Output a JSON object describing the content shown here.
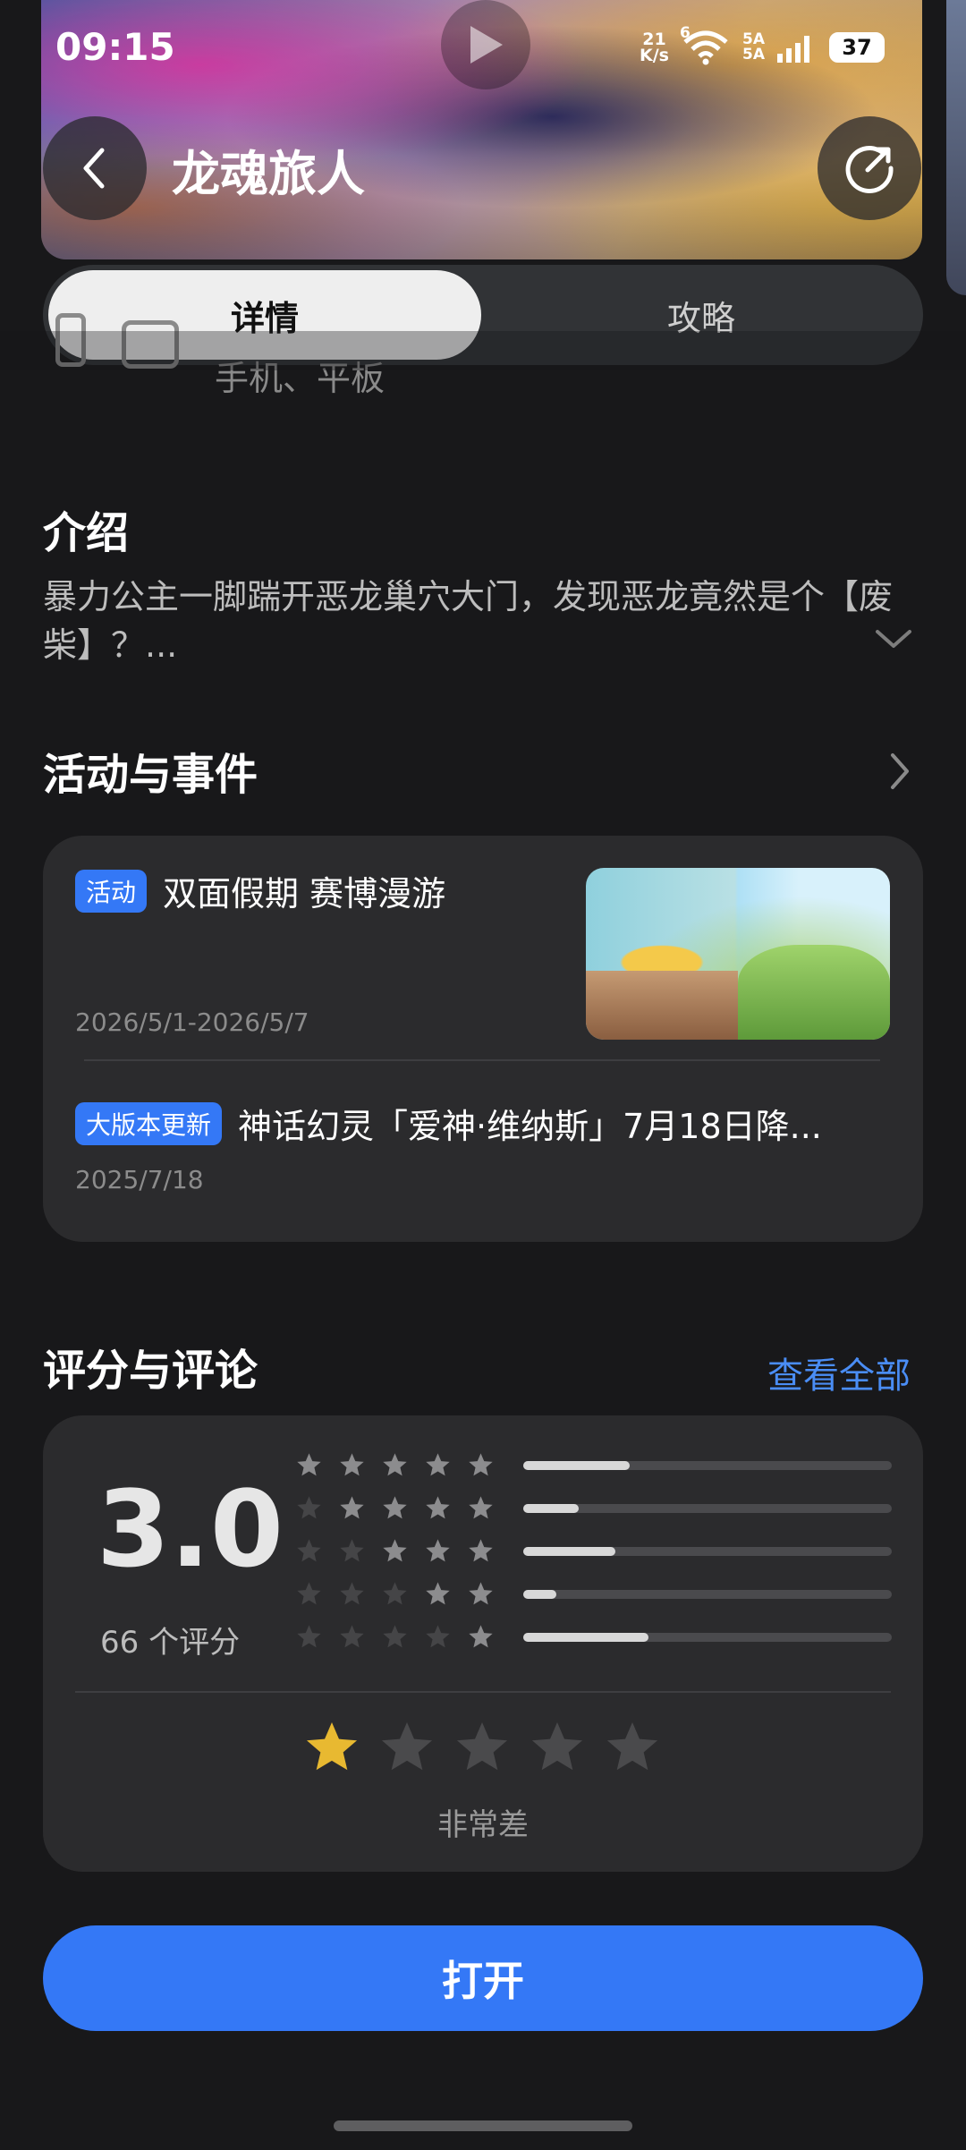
{
  "status_bar": {
    "time": "09:15",
    "net_speed_value": "21",
    "net_speed_unit": "K/s",
    "wifi_badge": "6",
    "sim1": "5A",
    "sim2": "5A",
    "battery": "37"
  },
  "header": {
    "title": "龙魂旅人",
    "back_icon": "chevron-left-icon",
    "share_icon": "share-icon"
  },
  "tabs": [
    {
      "label": "详情",
      "active": true
    },
    {
      "label": "攻略",
      "active": false
    }
  ],
  "devices": {
    "label": "手机、平板"
  },
  "intro": {
    "heading": "介绍",
    "text": "暴力公主一脚踹开恶龙巢穴大门，发现恶龙竟然是个【废柴】？..."
  },
  "events": {
    "heading": "活动与事件",
    "items": [
      {
        "tag": "活动",
        "title": "双面假期 赛博漫游",
        "date": "2026/5/1-2026/5/7"
      },
      {
        "tag": "大版本更新",
        "title": "神话幻灵「爱神·维纳斯」7月18日降...",
        "date": "2025/7/18"
      }
    ]
  },
  "ratings": {
    "heading": "评分与评论",
    "view_all": "查看全部",
    "score": "3.0",
    "count_text": "66 个评分",
    "distribution": [
      {
        "stars": 5,
        "fraction": 0.29
      },
      {
        "stars": 4,
        "fraction": 0.15
      },
      {
        "stars": 3,
        "fraction": 0.25
      },
      {
        "stars": 2,
        "fraction": 0.09
      },
      {
        "stars": 1,
        "fraction": 0.34
      }
    ],
    "user_rating": 1,
    "user_rating_label": "非常差"
  },
  "open_button": "打开",
  "colors": {
    "accent": "#3478f6",
    "link": "#4a8df5",
    "star_gold": "#e8b931",
    "background": "#18181a",
    "card": "#2b2b2d"
  }
}
